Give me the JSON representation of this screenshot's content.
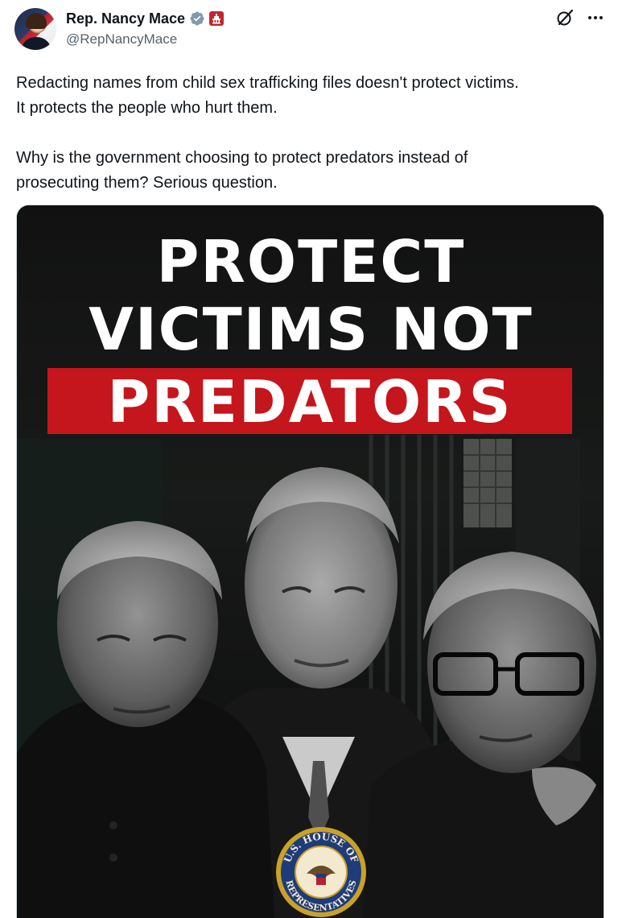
{
  "author": {
    "display_name": "Rep. Nancy Mace",
    "handle": "@RepNancyMace",
    "verified_icon": "verified-badge-icon",
    "affiliation_icon": "congress-affiliation-icon",
    "accent_color": "#1d9bf0",
    "affiliation_color": "#c1272d"
  },
  "actions": {
    "grok_icon": "grok-icon",
    "more_icon": "more-options-icon"
  },
  "tweet": {
    "paragraph_1_line_1": "Redacting names from child sex trafficking files doesn't protect victims.",
    "paragraph_1_line_2": "It protects the people who hurt them.",
    "paragraph_2_line_1": "Why is the government choosing to protect predators instead of",
    "paragraph_2_line_2": "prosecuting them? Serious question."
  },
  "media": {
    "headline_line_1": "PROTECT",
    "headline_line_2": "VICTIMS NOT",
    "headline_line_3": "PREDATORS",
    "highlight_color": "#c4161c",
    "seal_text_top": "U.S. HOUSE OF",
    "seal_text_bottom": "REPRESENTATIVES"
  }
}
